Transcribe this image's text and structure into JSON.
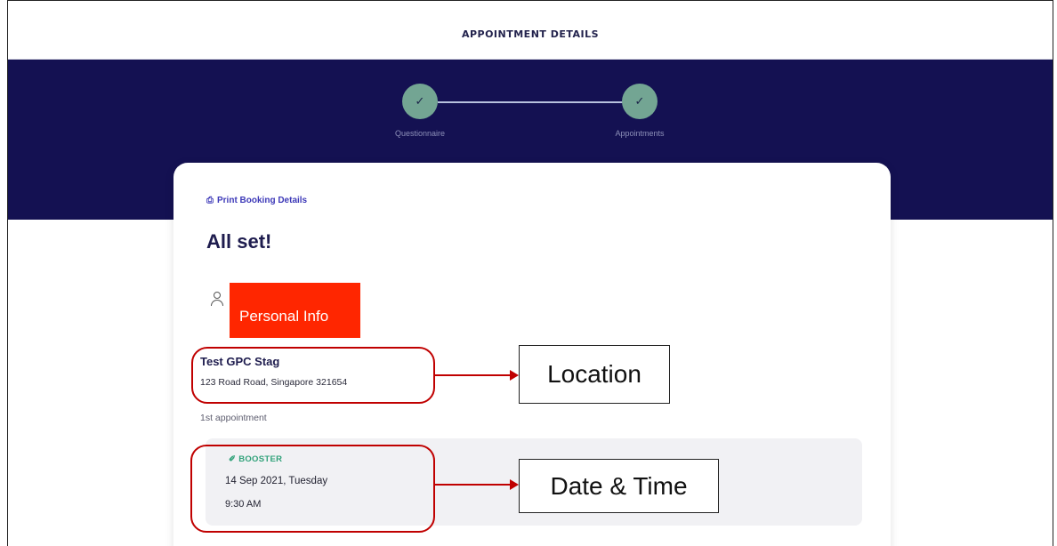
{
  "header": {
    "title": "APPOINTMENT DETAILS"
  },
  "steps": [
    {
      "label": "Questionnaire",
      "status_icon": "check-icon"
    },
    {
      "label": "Appointments",
      "status_icon": "check-icon"
    }
  ],
  "card": {
    "print_link": "Print Booking Details",
    "title": "All set!",
    "personal_info_label": "Personal Info",
    "location": {
      "name": "Test GPC Stag",
      "address": "123 Road Road, Singapore 321654"
    },
    "appointment_label": "1st appointment",
    "appointment": {
      "type": "BOOSTER",
      "date": "14 Sep 2021, Tuesday",
      "time": "9:30 AM"
    }
  },
  "annotations": {
    "location": "Location",
    "datetime": "Date & Time"
  },
  "colors": {
    "band": "#141152",
    "step": "#73a593",
    "accent": "#3d39b8",
    "booster": "#31a27a",
    "redact": "#ff2600",
    "annotation": "#c00000"
  }
}
